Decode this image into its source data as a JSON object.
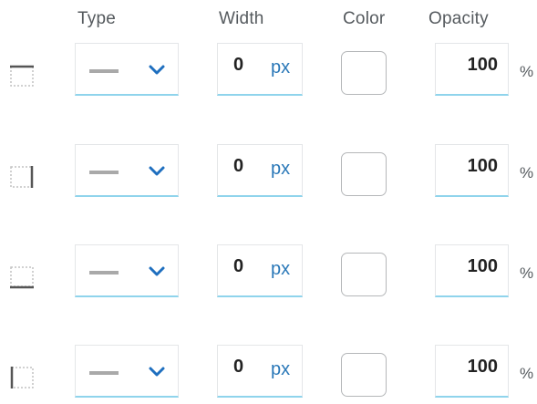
{
  "headers": {
    "type": "Type",
    "width": "Width",
    "color": "Color",
    "opacity": "Opacity"
  },
  "rows": [
    {
      "side": "top",
      "icon": "border-top-icon",
      "width": "0",
      "width_unit": "px",
      "opacity": "100",
      "percent": "%"
    },
    {
      "side": "right",
      "icon": "border-right-icon",
      "width": "0",
      "width_unit": "px",
      "opacity": "100",
      "percent": "%"
    },
    {
      "side": "bottom",
      "icon": "border-bottom-icon",
      "width": "0",
      "width_unit": "px",
      "opacity": "100",
      "percent": "%"
    },
    {
      "side": "left",
      "icon": "border-left-icon",
      "width": "0",
      "width_unit": "px",
      "opacity": "100",
      "percent": "%"
    }
  ],
  "colors": {
    "accent_underline": "#8fd4ec",
    "chevron": "#1f6fbf",
    "unit_text": "#2a78b8",
    "line_preview": "#a9a9a9",
    "swatch_value": "#ffffff"
  },
  "icons": {
    "chevron": "chevron-down-icon",
    "line_style": "solid-line-icon"
  }
}
